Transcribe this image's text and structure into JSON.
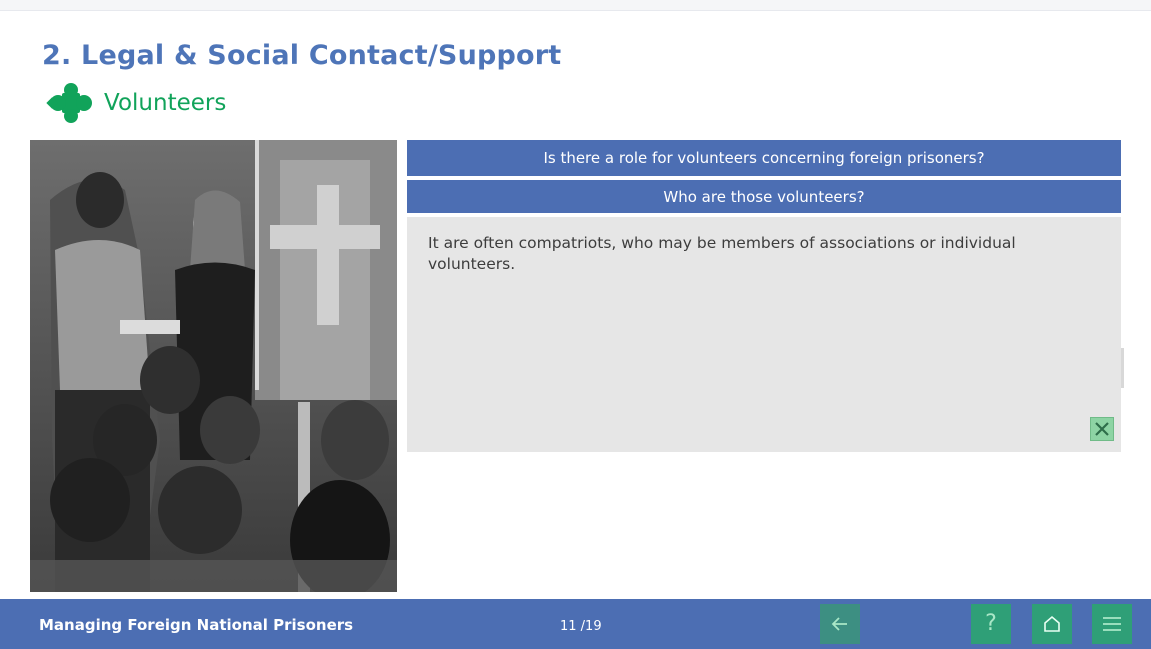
{
  "title": "2. Legal & Social Contact/Support",
  "subtitle": "Volunteers",
  "questions": [
    "Is there a role for volunteers concerning foreign prisoners?",
    "Who are those volunteers?"
  ],
  "answer": "It are often compatriots, who may be members of associations or individual volunteers.",
  "footer": {
    "course_title": "Managing Foreign National Prisoners",
    "page": "11 /19"
  },
  "icons": {
    "subtitle": "puzzle-piece-icon",
    "close": "close-icon",
    "back": "arrow-left-icon",
    "help": "question-icon",
    "home": "home-icon",
    "menu": "hamburger-menu-icon"
  },
  "colors": {
    "primary_blue": "#4c6eb3",
    "title_blue": "#4e75b8",
    "accent_green": "#11a35a",
    "button_green": "#2f9f77",
    "answer_bg": "#e6e6e6"
  }
}
